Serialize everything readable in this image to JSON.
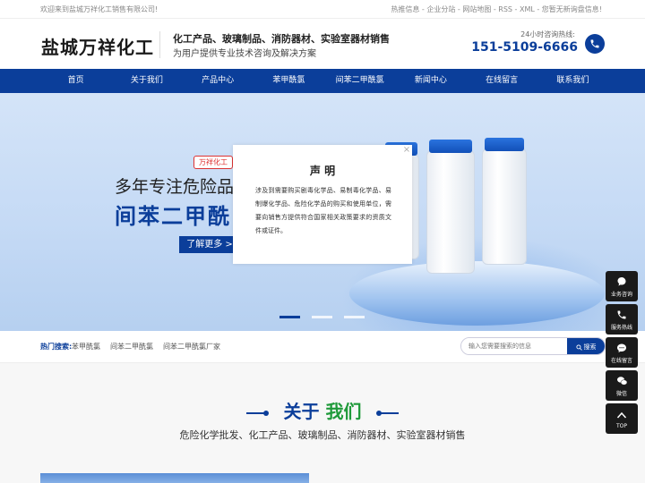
{
  "topbar": {
    "welcome": "欢迎来到盐城万祥化工销售有限公司!",
    "links": "热推信息 - 企业分站 - 网站地图 - RSS - XML - 您暂无新询盘信息!"
  },
  "header": {
    "logo": "盐城万祥化工",
    "slogan_main": "化工产品、玻璃制品、消防器材、实验室器材销售",
    "slogan_sub": "为用户提供专业技术咨询及解决方案",
    "hotline_label": "24小时咨询热线:",
    "hotline_number": "151-5109-6666",
    "phone_icon": "phone-icon"
  },
  "nav": {
    "items": [
      "首页",
      "关于我们",
      "产品中心",
      "苯甲酰氯",
      "间苯二甲酰氯",
      "新闻中心",
      "在线留言",
      "联系我们"
    ]
  },
  "banner": {
    "brand_tag": "万祥化工",
    "headline": "多年专注危险品化",
    "product": "间苯二甲酰",
    "more_button": "了解更多 >",
    "slide_count": 3,
    "active_slide": 1
  },
  "modal": {
    "title": "声 明",
    "body": "涉及到需要购买剧毒化学品、易制毒化学品、易制爆化学品、危险化学品的购买和使用单位，需要向销售方提供符合国家相关政策要求的资质文件或证件。",
    "close_icon": "close-icon"
  },
  "search": {
    "hot_label": "热门搜索:",
    "hot_items": [
      "苯甲酰氯",
      "间苯二甲酰氯",
      "间苯二甲酰氯厂家"
    ],
    "placeholder": "输入您需要搜索的信息",
    "button_label": "搜索"
  },
  "about": {
    "title_part1": "关于",
    "title_part2": "我们",
    "subtitle": "危险化学批发、化工产品、玻璃制品、消防器材、实验室器材销售"
  },
  "float_bar": {
    "items": [
      {
        "label": "业务咨询",
        "icon": "chat-bubble-icon"
      },
      {
        "label": "服务热线",
        "icon": "phone-icon"
      },
      {
        "label": "在线留言",
        "icon": "message-icon"
      },
      {
        "label": "微信",
        "icon": "wechat-icon"
      },
      {
        "label": "TOP",
        "icon": "arrow-up-icon"
      }
    ]
  },
  "colors": {
    "primary": "#0b3e9a",
    "accent_green": "#1f9a3a",
    "brand_red": "#dd3333"
  }
}
